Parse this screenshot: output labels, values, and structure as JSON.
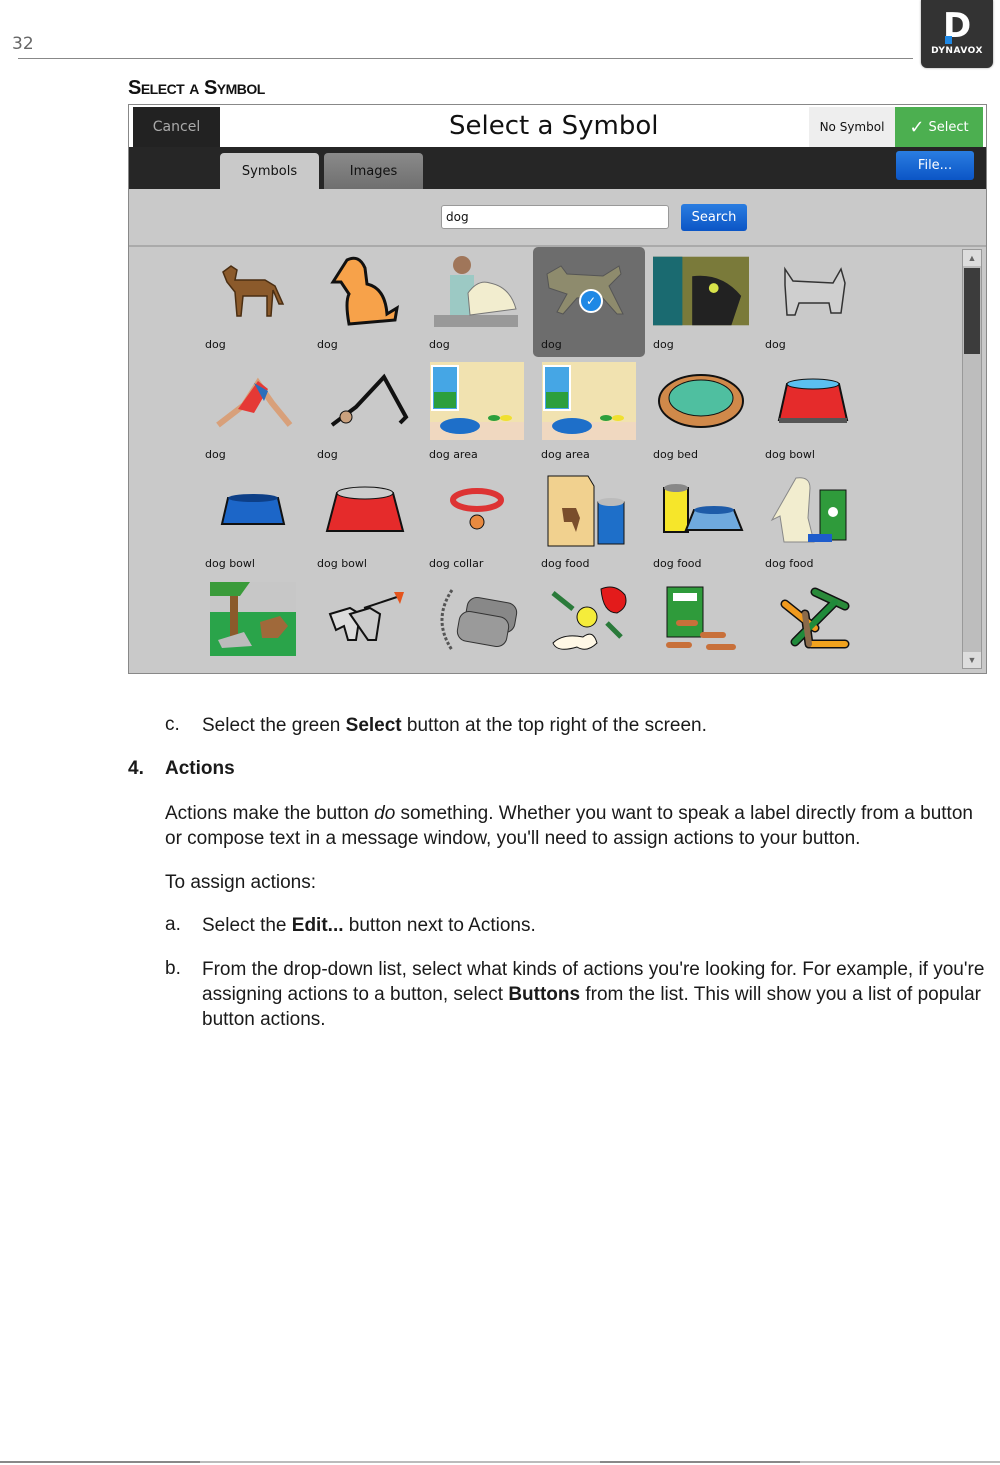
{
  "page": {
    "number": "32",
    "logo_text": "DYNAVOX",
    "logo_letter": "D",
    "section_title": "Select a Symbol"
  },
  "app": {
    "title": "Select a Symbol",
    "cancel_label": "Cancel",
    "no_symbol_label": "No Symbol",
    "select_label": "Select",
    "select_icon": "checkmark-icon",
    "file_label": "File...",
    "tabs": [
      {
        "label": "Symbols",
        "active": true
      },
      {
        "label": "Images",
        "active": false
      }
    ],
    "search": {
      "value": "dog",
      "button_label": "Search"
    },
    "symbols": [
      {
        "label": "dog",
        "icon": "brown-dog-standing",
        "selected": false
      },
      {
        "label": "dog",
        "icon": "orange-dog-sitting",
        "selected": false
      },
      {
        "label": "dog",
        "icon": "woman-with-dog",
        "selected": false
      },
      {
        "label": "dog",
        "icon": "dog-running",
        "selected": true
      },
      {
        "label": "dog",
        "icon": "photo-dog-with-ball",
        "selected": false
      },
      {
        "label": "dog",
        "icon": "gray-terrier",
        "selected": false
      },
      {
        "label": "dog",
        "icon": "yoga-pose-color",
        "selected": false
      },
      {
        "label": "dog",
        "icon": "yoga-pose-stick",
        "selected": false
      },
      {
        "label": "dog area",
        "icon": "dog-area-room",
        "selected": false
      },
      {
        "label": "dog area",
        "icon": "dog-area-room",
        "selected": false
      },
      {
        "label": "dog bed",
        "icon": "dog-bed",
        "selected": false
      },
      {
        "label": "dog bowl",
        "icon": "red-bowl-water",
        "selected": false
      },
      {
        "label": "dog bowl",
        "icon": "blue-bowl",
        "selected": false
      },
      {
        "label": "dog bowl",
        "icon": "red-bowl",
        "selected": false
      },
      {
        "label": "dog collar",
        "icon": "dog-collar",
        "selected": false
      },
      {
        "label": "dog food",
        "icon": "food-bag-can",
        "selected": false
      },
      {
        "label": "dog food",
        "icon": "can-and-bowl",
        "selected": false
      },
      {
        "label": "dog food",
        "icon": "dog-with-food-bag",
        "selected": false
      },
      {
        "label": "",
        "icon": "dogs-in-yard",
        "selected": false
      },
      {
        "label": "",
        "icon": "dogs-on-leash",
        "selected": false
      },
      {
        "label": "",
        "icon": "dog-tags",
        "selected": false
      },
      {
        "label": "",
        "icon": "dog-toys",
        "selected": false
      },
      {
        "label": "",
        "icon": "dog-treats-box",
        "selected": false
      },
      {
        "label": "",
        "icon": "dog-bones",
        "selected": false
      }
    ]
  },
  "content": {
    "step_c": {
      "marker": "c.",
      "pre": "Select the green ",
      "bold": "Select",
      "post": " button at the top right of the screen."
    },
    "heading": {
      "number": "4.",
      "text": "Actions"
    },
    "para1": {
      "pre": "Actions make the button ",
      "ital": "do",
      "post": " something. Whether you want to speak a label directly from a button or compose text in a message window, you'll need to assign actions to your button."
    },
    "para2": "To assign actions:",
    "step_a": {
      "marker": "a.",
      "pre": "Select the ",
      "bold": "Edit...",
      "post": " button next to Actions."
    },
    "step_b": {
      "marker": "b.",
      "pre": "From the drop-down list, select what kinds of actions you're looking for. For example, if you're assigning actions to a button, select ",
      "bold": "Buttons",
      "post": " from the list. This will show you a list of popular button actions."
    }
  },
  "colors": {
    "select_green": "#4caf50",
    "action_blue": "#1565d8",
    "dark_bar": "#262626"
  }
}
